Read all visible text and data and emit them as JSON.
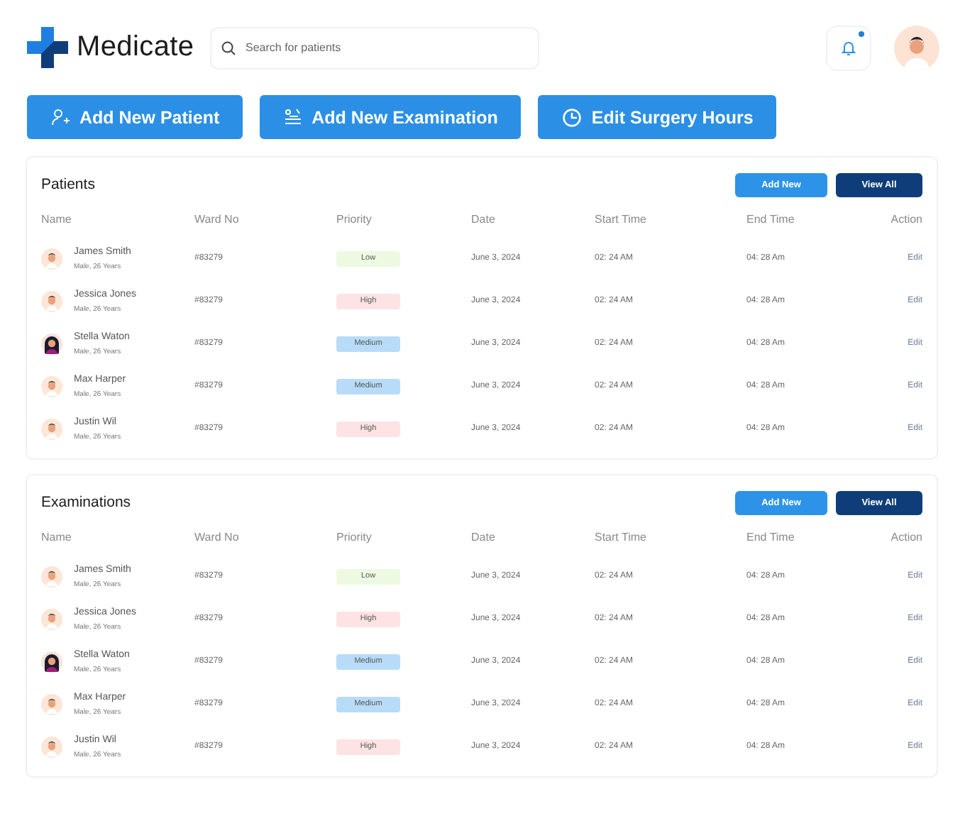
{
  "header": {
    "logo_text": "Medicate",
    "search": {
      "placeholder": "Search for patients"
    },
    "notifications": {
      "unread": true
    }
  },
  "actions": [
    {
      "label": "Add New Patient"
    },
    {
      "label": "Add New Examination"
    },
    {
      "label": "Edit Surgery Hours"
    }
  ],
  "sections": [
    {
      "title": "Patients",
      "buttons": [
        {
          "label": "Add New",
          "kind": "primary"
        },
        {
          "label": "View All",
          "kind": "dark"
        }
      ],
      "columns": [
        "Name",
        "Ward No",
        "Priority",
        "Date",
        "Start Time",
        "End Time",
        "Action"
      ],
      "rows": [
        {
          "name": "James Smith",
          "info": "Male, 26 Years",
          "kind": "male",
          "ward": "#83279",
          "priority": "Low",
          "color": "#eef9e2",
          "date": "June 3, 2024",
          "start": "02: 24 AM",
          "end": "04: 28 Am",
          "action": "Edit"
        },
        {
          "name": "Jessica Jones",
          "info": "Male, 26 Years",
          "kind": "male",
          "ward": "#83279",
          "priority": "High",
          "color": "#fde3e3",
          "date": "June 3, 2024",
          "start": "02: 24 AM",
          "end": "04: 28 Am",
          "action": "Edit"
        },
        {
          "name": "Stella Waton",
          "info": "Male, 26 Years",
          "kind": "female",
          "ward": "#83279",
          "priority": "Medium",
          "color": "#b8dcf8",
          "date": "June 3, 2024",
          "start": "02: 24 AM",
          "end": "04: 28 Am",
          "action": "Edit"
        },
        {
          "name": "Max Harper",
          "info": "Male, 26 Years",
          "kind": "male",
          "ward": "#83279",
          "priority": "Medium",
          "color": "#b8dcf8",
          "date": "June 3, 2024",
          "start": "02: 24 AM",
          "end": "04: 28 Am",
          "action": "Edit"
        },
        {
          "name": "Justin Wil",
          "info": "Male, 26 Years",
          "kind": "male",
          "ward": "#83279",
          "priority": "High",
          "color": "#fde3e3",
          "date": "June 3, 2024",
          "start": "02: 24 AM",
          "end": "04: 28 Am",
          "action": "Edit"
        }
      ]
    },
    {
      "title": "Examinations",
      "buttons": [
        {
          "label": "Add New",
          "kind": "primary"
        },
        {
          "label": "View All",
          "kind": "dark"
        }
      ],
      "columns": [
        "Name",
        "Ward No",
        "Priority",
        "Date",
        "Start Time",
        "End Time",
        "Action"
      ],
      "rows": [
        {
          "name": "James Smith",
          "info": "Male, 26 Years",
          "kind": "male",
          "ward": "#83279",
          "priority": "Low",
          "color": "#eef9e2",
          "date": "June 3, 2024",
          "start": "02: 24 AM",
          "end": "04: 28 Am",
          "action": "Edit"
        },
        {
          "name": "Jessica Jones",
          "info": "Male, 26 Years",
          "kind": "male",
          "ward": "#83279",
          "priority": "High",
          "color": "#fde3e3",
          "date": "June 3, 2024",
          "start": "02: 24 AM",
          "end": "04: 28 Am",
          "action": "Edit"
        },
        {
          "name": "Stella Waton",
          "info": "Male, 26 Years",
          "kind": "female",
          "ward": "#83279",
          "priority": "Medium",
          "color": "#b8dcf8",
          "date": "June 3, 2024",
          "start": "02: 24 AM",
          "end": "04: 28 Am",
          "action": "Edit"
        },
        {
          "name": "Max Harper",
          "info": "Male, 26 Years",
          "kind": "male",
          "ward": "#83279",
          "priority": "Medium",
          "color": "#b8dcf8",
          "date": "June 3, 2024",
          "start": "02: 24 AM",
          "end": "04: 28 Am",
          "action": "Edit"
        },
        {
          "name": "Justin Wil",
          "info": "Male, 26 Years",
          "kind": "male",
          "ward": "#83279",
          "priority": "High",
          "color": "#fde3e3",
          "date": "June 3, 2024",
          "start": "02: 24 AM",
          "end": "04: 28 Am",
          "action": "Edit"
        }
      ]
    }
  ]
}
